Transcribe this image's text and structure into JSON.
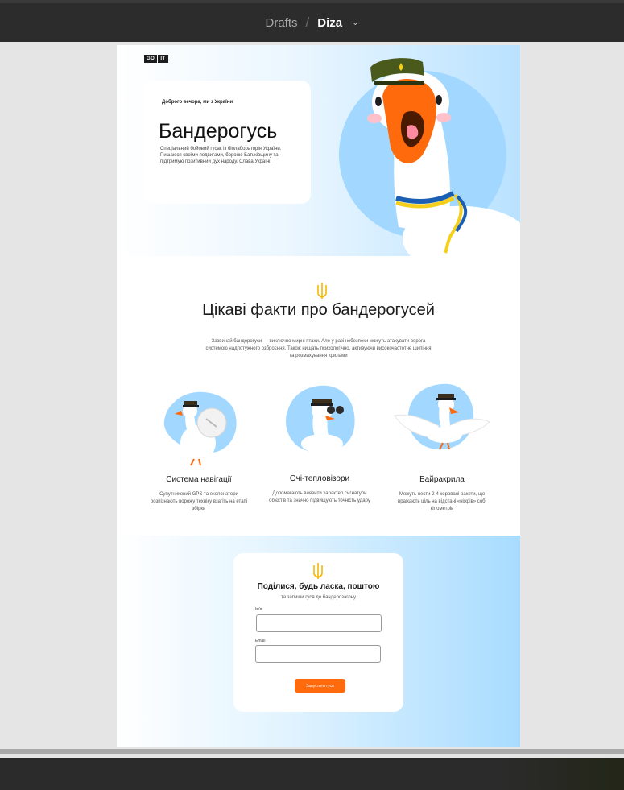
{
  "app": {
    "breadcrumb_parent": "Drafts",
    "breadcrumb_separator": "/",
    "file_name": "Diza",
    "chevron_glyph": "⌄"
  },
  "hero": {
    "logo_left": "GO",
    "logo_right": "IT",
    "greeting": "Доброго вечора, ми з України",
    "title": "Бандерогусь",
    "description": "Спеціальний бойовий гусак із біолабораторія України. Пишаюся своїми подвигами, бороню Батьківщину та підтримую позитивний дух народу. Слава Україні!"
  },
  "facts": {
    "title": "Цікаві факти про бандерогусей",
    "description": "Зазвичай бандерогуси — виключно мирні птахи. Але у разі небезпеки можуть атакувати ворога системою надпотужного озброєння. Також нищать психологічно, активуючи високочастотне шипіння та розмахування крилами",
    "items": [
      {
        "title": "Система навігації",
        "description": "Супутниковий GPS та екопонатори розпізнають ворожу техніку взагіть на етапі збірки"
      },
      {
        "title": "Очі-тепловізори",
        "description": "Допомагають виявити характер сигнатури об'єктів та значно підвищують точність удару"
      },
      {
        "title": "Байракрила",
        "description": "Можуть нести 2-4 керовані ракети, що вражають ціль на відстані «ніжрів» собі кілометрів"
      }
    ]
  },
  "form": {
    "title": "Поділися, будь ласка, поштою",
    "subtitle": "та запиши гуся до бандерозагону",
    "name_label": "Ім'я",
    "name_value": "",
    "email_label": "Email",
    "email_value": "",
    "submit_label": "Запустити гуся"
  },
  "colors": {
    "accent_orange": "#ff6a0d",
    "sky_blue": "#a8dcff",
    "ukraine_blue": "#1a5fb4",
    "ukraine_yellow": "#f5cf1a",
    "toolbar_bg": "#2c2c2c"
  },
  "icons": [
    "trident-icon",
    "chevron-down-icon",
    "goose-illustration"
  ]
}
